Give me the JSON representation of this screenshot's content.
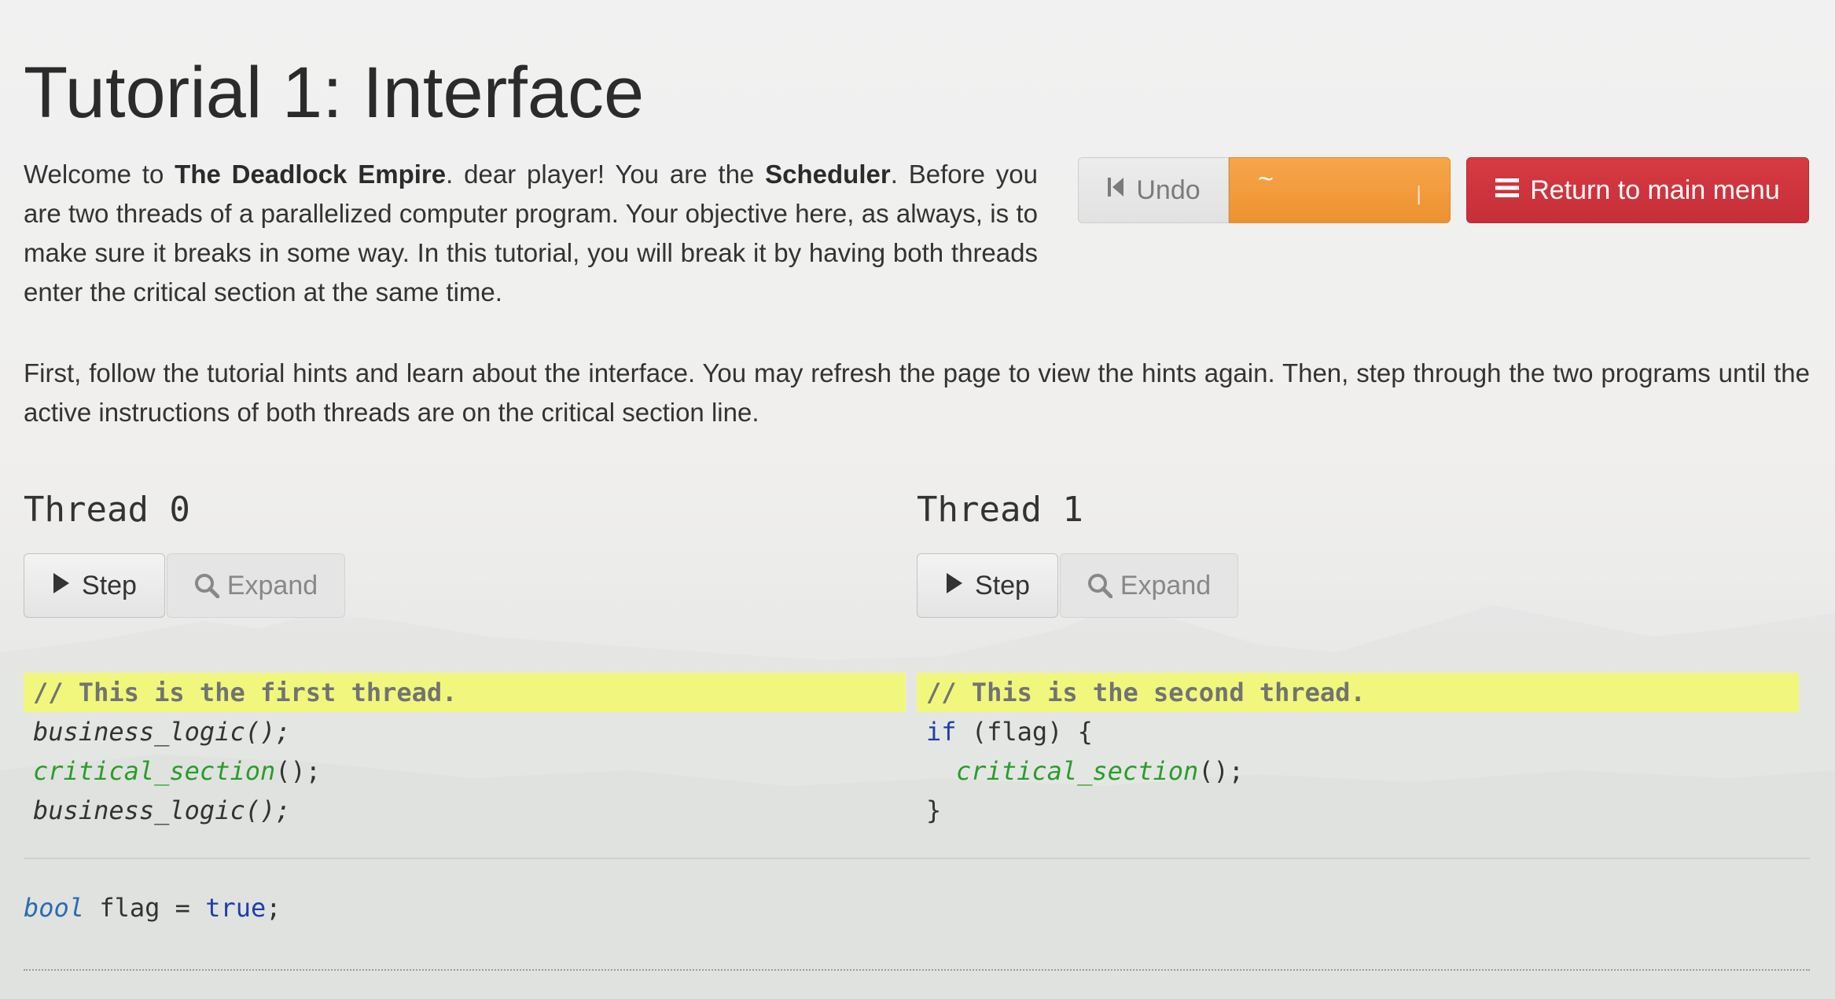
{
  "page": {
    "title": "Tutorial 1: Interface",
    "intro": {
      "t1": "Welcome to ",
      "b1": "The Deadlock Empire",
      "t2": ". dear player! You are the ",
      "b2": "Scheduler",
      "t3": ". Before you are two threads of a parallelized computer program. Your objective here, as always, is to make sure it breaks in some way. In this tutorial, you will break it by having both threads enter the critical section at the same time."
    },
    "second_paragraph": "First, follow the tutorial hints and learn about the interface. You may refresh the page to view the hints again. Then, step through the two programs until the active instructions of both threads are on the critical section line."
  },
  "toolbar": {
    "undo_icon": "skip-back-icon",
    "undo_label": "Undo",
    "orange_left_glyph": "~",
    "orange_right_glyph": "|",
    "return_icon": "menu-lines-icon",
    "return_label": "Return to main menu"
  },
  "threads": [
    {
      "title": "Thread 0",
      "step_label": "Step",
      "expand_label": "Expand",
      "code": {
        "l0": "// This is the first thread.",
        "l1_fn": "business_logic",
        "l1_rest": "();",
        "l2_fn": "critical_section",
        "l2_rest": "();",
        "l3_fn": "business_logic",
        "l3_rest": "();"
      }
    },
    {
      "title": "Thread 1",
      "step_label": "Step",
      "expand_label": "Expand",
      "code": {
        "l0": "// This is the second thread.",
        "l1_kw": "if",
        "l1_rest": " (flag) {",
        "l2_fn": "critical_section",
        "l2_rest": "();",
        "l3": "}"
      }
    }
  ],
  "globals": {
    "type": "bool",
    "name": " flag = ",
    "value": "true",
    "end": ";"
  },
  "colors": {
    "highlight": "#f1f77d",
    "critical": "#2a9d2a",
    "keyword": "#1f3ea8",
    "orange": "#ec9230",
    "red": "#c62f38"
  }
}
